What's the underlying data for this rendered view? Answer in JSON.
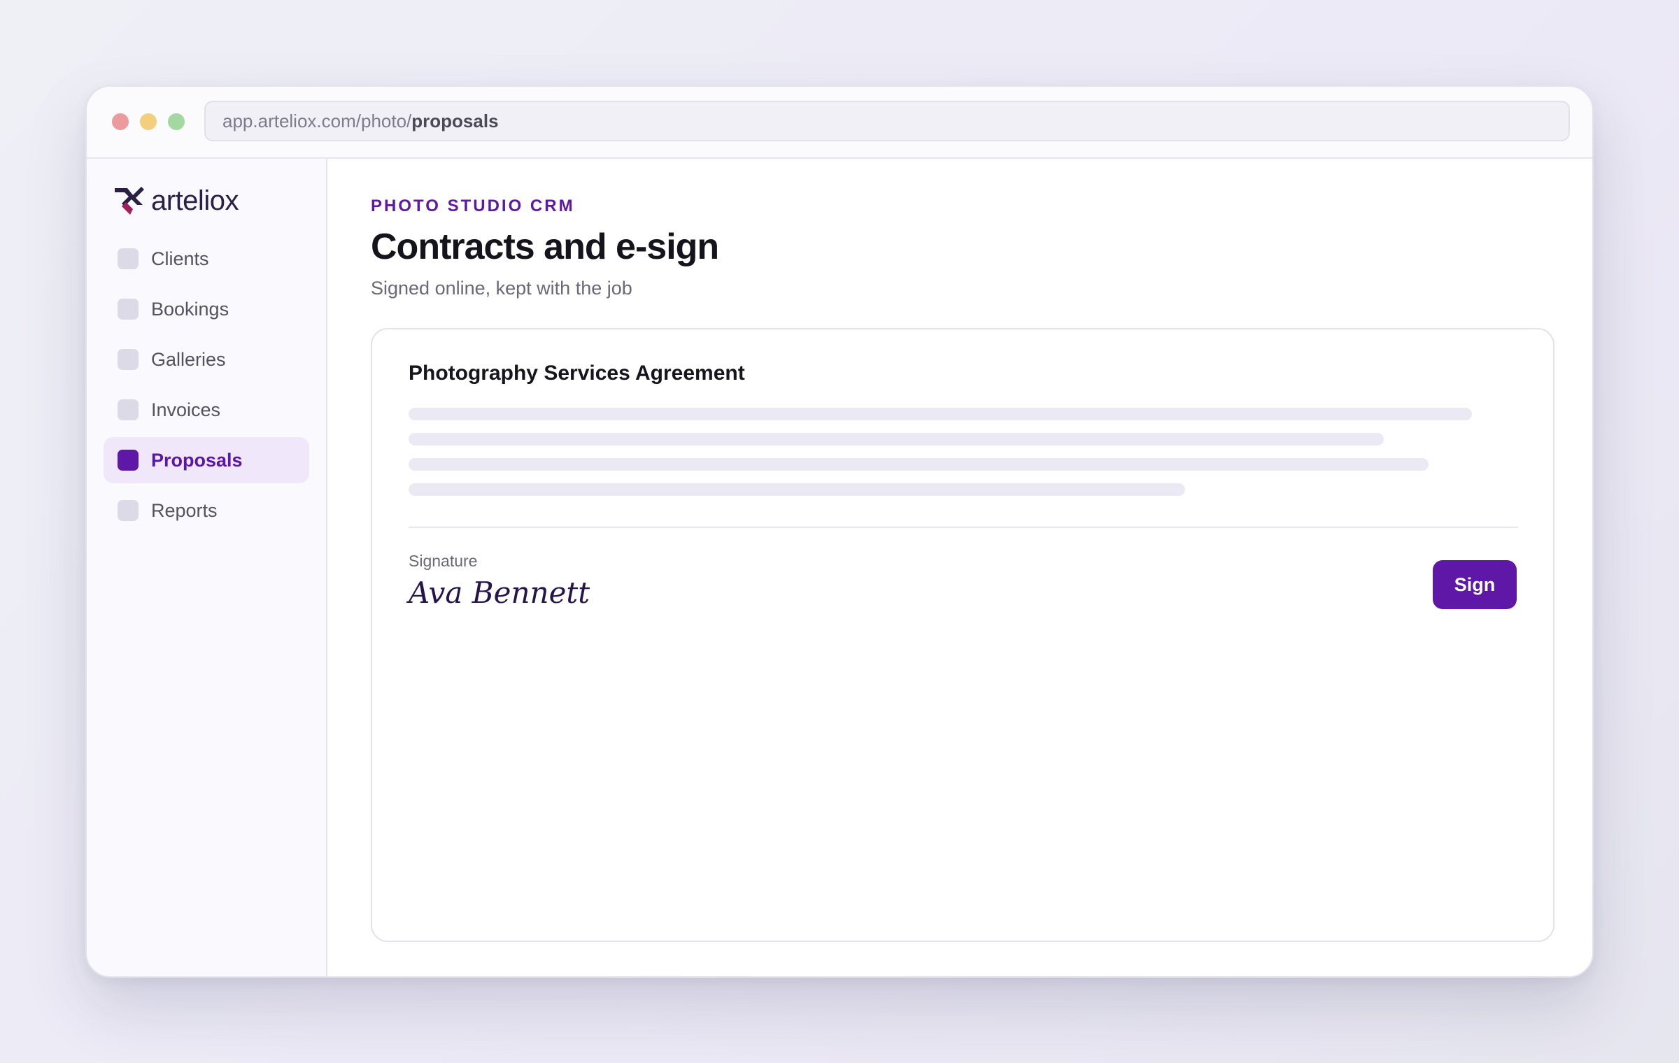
{
  "browser": {
    "url_prefix": "app.arteliox.com/photo/",
    "url_current": "proposals"
  },
  "brand": {
    "name": "arteliox",
    "accent_color": "#5f17a8"
  },
  "sidebar": {
    "items": [
      {
        "label": "Clients",
        "active": false
      },
      {
        "label": "Bookings",
        "active": false
      },
      {
        "label": "Galleries",
        "active": false
      },
      {
        "label": "Invoices",
        "active": false
      },
      {
        "label": "Proposals",
        "active": true
      },
      {
        "label": "Reports",
        "active": false
      }
    ]
  },
  "header": {
    "eyebrow": "PHOTO STUDIO CRM",
    "title": "Contracts and e-sign",
    "subtitle": "Signed online, kept with the job"
  },
  "contract": {
    "title": "Photography Services Agreement",
    "signature_label": "Signature",
    "signature_value": "Ava Bennett",
    "sign_button": "Sign"
  }
}
